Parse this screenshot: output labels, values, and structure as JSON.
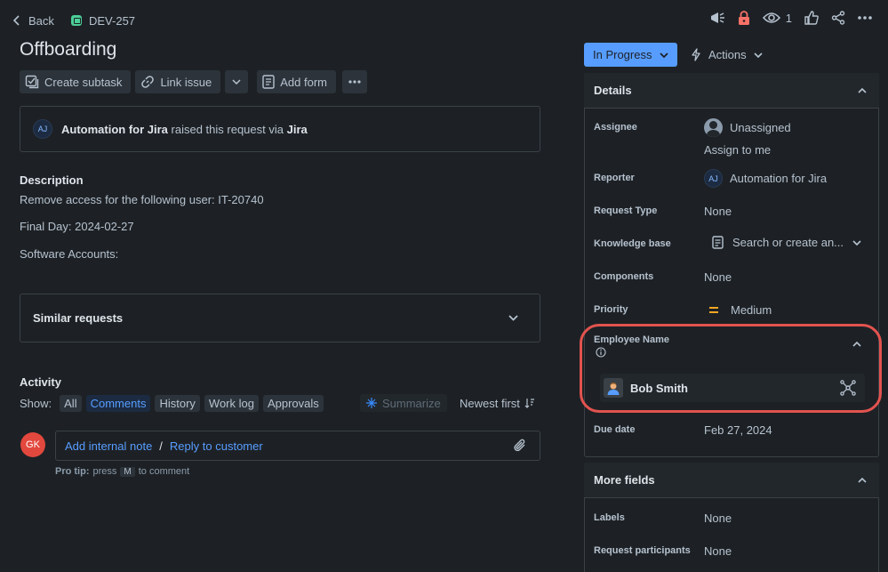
{
  "header": {
    "back_label": "Back",
    "issue_key": "DEV-257",
    "watchers_count": "1"
  },
  "issue": {
    "title": "Offboarding"
  },
  "toolbar": {
    "create_subtask": "Create subtask",
    "link_issue": "Link issue",
    "add_form": "Add form"
  },
  "request_info": {
    "avatar_initials": "AJ",
    "actor": "Automation for Jira",
    "middle_text": "raised this request via",
    "channel": "Jira"
  },
  "description": {
    "heading": "Description",
    "lines": [
      "Remove access for the following user: IT-20740",
      "Final Day: 2024-02-27",
      "Software Accounts:"
    ]
  },
  "similar_requests": {
    "label": "Similar requests"
  },
  "activity": {
    "heading": "Activity",
    "show_label": "Show:",
    "filters": [
      "All",
      "Comments",
      "History",
      "Work log",
      "Approvals"
    ],
    "active_filter": "Comments",
    "summarize_label": "Summarize",
    "sort_label": "Newest first",
    "user_initials": "GK",
    "add_internal_note": "Add internal note",
    "separator": "/",
    "reply_to_customer": "Reply to customer",
    "pro_tip_prefix": "Pro tip:",
    "pro_tip_press": "press",
    "pro_tip_key": "M",
    "pro_tip_suffix": "to comment"
  },
  "status": {
    "label": "In Progress",
    "actions_label": "Actions"
  },
  "details": {
    "heading": "Details",
    "assignee_label": "Assignee",
    "assignee_value": "Unassigned",
    "assign_to_me": "Assign to me",
    "reporter_label": "Reporter",
    "reporter_initials": "AJ",
    "reporter_value": "Automation for Jira",
    "request_type_label": "Request Type",
    "request_type_value": "None",
    "knowledge_base_label": "Knowledge base",
    "knowledge_base_value": "Search or create an...",
    "components_label": "Components",
    "components_value": "None",
    "priority_label": "Priority",
    "priority_value": "Medium",
    "employee_name_label": "Employee Name",
    "employee_name_value": "Bob Smith",
    "due_date_label": "Due date",
    "due_date_value": "Feb 27, 2024"
  },
  "more_fields": {
    "heading": "More fields",
    "labels_label": "Labels",
    "labels_value": "None",
    "participants_label": "Request participants",
    "participants_value": "None"
  },
  "colors": {
    "background": "#1d2125",
    "accent": "#579dff",
    "highlight": "#e2534f",
    "priority_medium": "#f5a623"
  }
}
